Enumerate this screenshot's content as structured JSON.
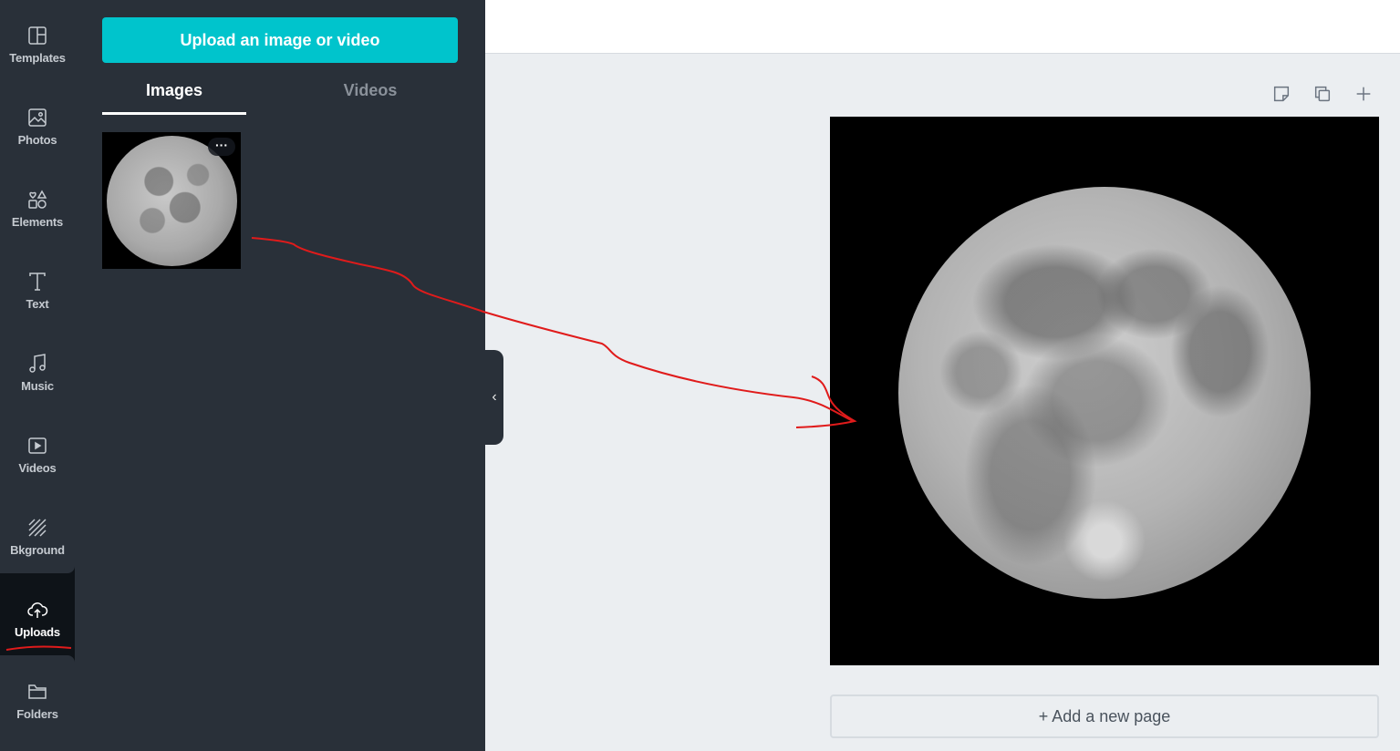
{
  "rail": {
    "items": [
      {
        "label": "Templates",
        "icon": "templates-icon"
      },
      {
        "label": "Photos",
        "icon": "photo-icon"
      },
      {
        "label": "Elements",
        "icon": "shapes-icon"
      },
      {
        "label": "Text",
        "icon": "text-icon"
      },
      {
        "label": "Music",
        "icon": "music-note-icon"
      },
      {
        "label": "Videos",
        "icon": "video-play-icon"
      },
      {
        "label": "Bkground",
        "icon": "background-stripes-icon"
      },
      {
        "label": "Uploads",
        "icon": "cloud-upload-icon",
        "active": true
      },
      {
        "label": "Folders",
        "icon": "folder-icon"
      }
    ]
  },
  "panel": {
    "upload_button": "Upload an image or video",
    "tabs": [
      {
        "label": "Images",
        "active": true
      },
      {
        "label": "Videos",
        "active": false
      }
    ],
    "thumbnail_more": "···"
  },
  "collapse_label": "‹",
  "canvas": {
    "add_page_label": "+ Add a new page"
  },
  "colors": {
    "accent": "#00c4cc",
    "panel_bg": "#293039",
    "rail_bg": "#0e1318",
    "workspace_bg": "#ebeef1",
    "annotation": "#e01b1b"
  }
}
